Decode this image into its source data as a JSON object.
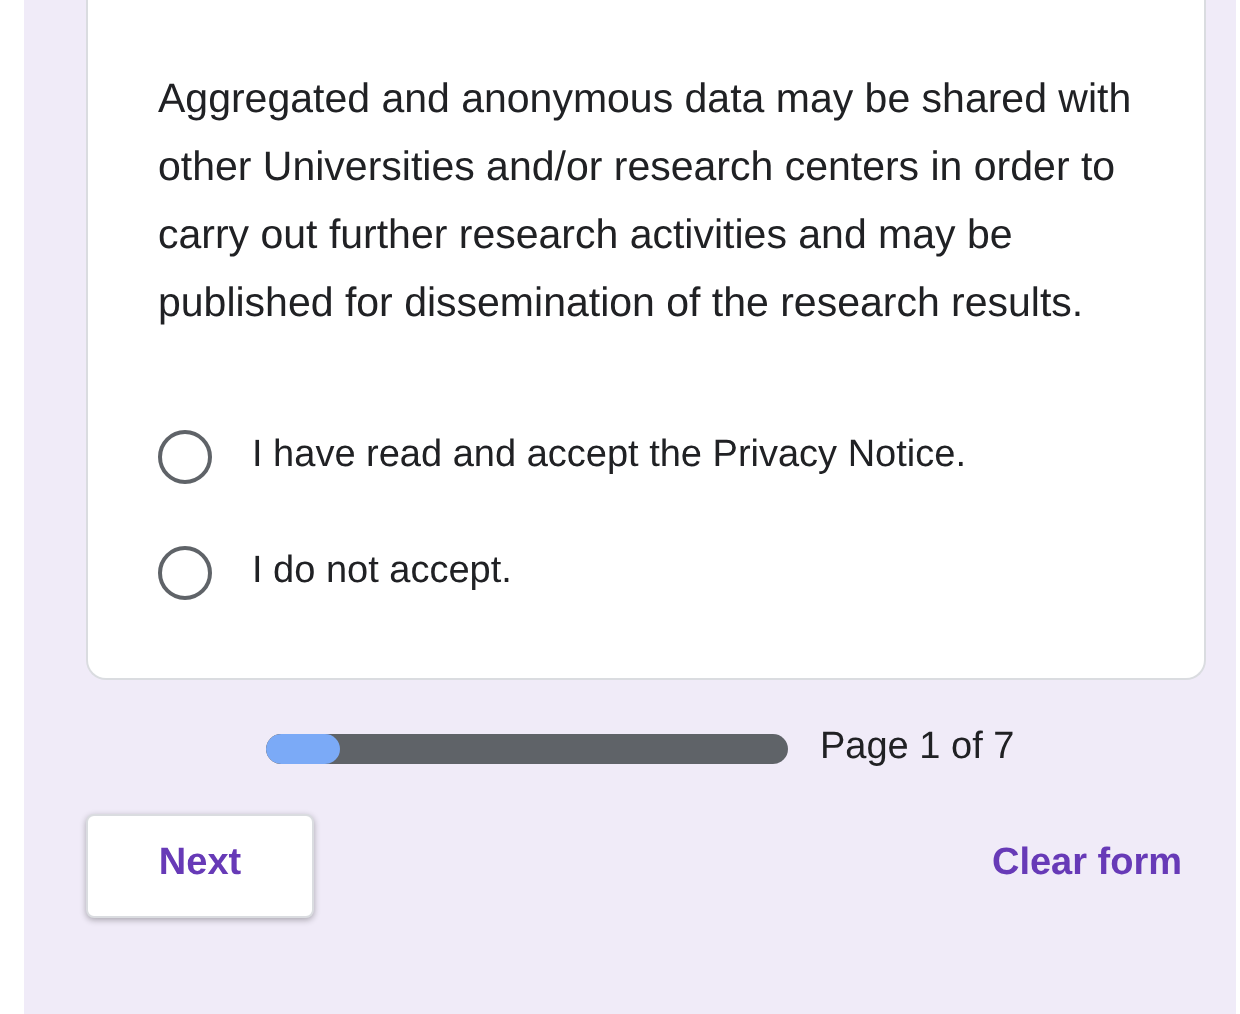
{
  "question": {
    "text": "Aggregated and anonymous data may be shared with other Universities and/or research centers in order to carry out further research activities and may be published for dissemination of the research results."
  },
  "options": [
    {
      "label": "I have read and accept the Privacy Notice.",
      "selected": false
    },
    {
      "label": "I do not accept.",
      "selected": false
    }
  ],
  "progress": {
    "level": 0.143,
    "reading": "Page 1 of 7"
  },
  "buttons": {
    "next": "Next",
    "clear": "Clear form"
  }
}
